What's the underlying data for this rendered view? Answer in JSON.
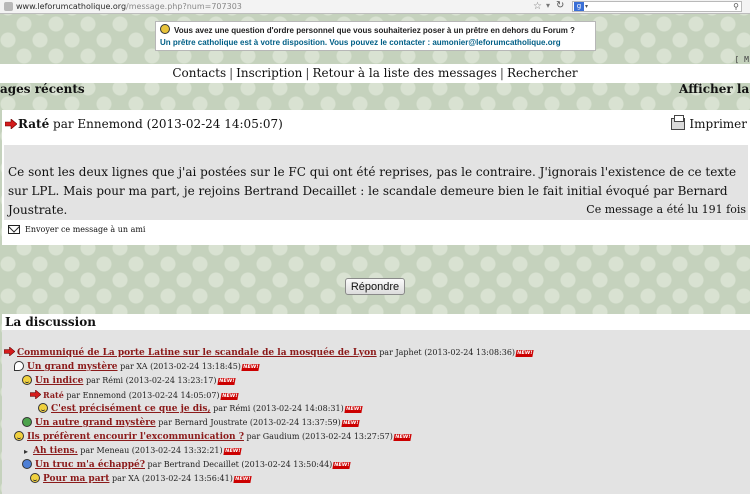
{
  "browser": {
    "url_domain": "www.leforumcatholique.org",
    "url_path": "/message.php?num=707303"
  },
  "notice": {
    "line1": "Vous avez une question d'ordre personnel que vous souhaiteriez poser à un prêtre en dehors du Forum ?",
    "line2": "Un prêtre catholique est à votre disposition. Vous pouvez le contacter : aumonier@leforumcatholique.org"
  },
  "edge_label": "[ M",
  "nav": {
    "contacts": "Contacts",
    "inscription": "Inscription",
    "retour": "Retour à la liste des messages",
    "rechercher": "Rechercher",
    "sep": "|"
  },
  "recent": {
    "left": "ages récents",
    "right": "Afficher la dis"
  },
  "message": {
    "title": "Raté",
    "by": "par Ennemond (2013-02-24 14:05:07)",
    "print_label": "Imprimer",
    "body": "Ce sont les deux lignes que j'ai postées sur le FC qui ont été reprises, pas le contraire. J'ignorais l'existence de ce texte sur LPL. Mais pour ma part, je rejoins Bertrand Decaillet : le scandale demeure bien le fait initial évoqué par Bernard Joustrate.",
    "read_count": "Ce message a été lu 191 fois",
    "send_label": "Envoyer ce message à un ami"
  },
  "reply_label": "Répondre",
  "discussion": {
    "heading": "La discussion",
    "new_badge": "NEW!",
    "rows": [
      {
        "title": "Communiqué de La porte Latine sur le scandale de la mosquée de Lyon",
        "meta": "par Japhet (2013-02-24 13:08:36)",
        "icon": "red-arrow"
      },
      {
        "title": "Un grand mystère",
        "meta": "par XA (2013-02-24 13:18:45)",
        "icon": "speech-bubble"
      },
      {
        "title": "Un indice",
        "meta": "par Rémi (2013-02-24 13:23:17)",
        "icon": "smiley"
      },
      {
        "title": "Raté",
        "meta": "par Ennemond (2013-02-24 14:05:07)",
        "icon": "red-arrow"
      },
      {
        "title": "C'est précisément ce que je dis,",
        "meta": "par Rémi (2013-02-24 14:08:31)",
        "icon": "smiley"
      },
      {
        "title": "Un autre grand mystère",
        "meta": "par Bernard Joustrate (2013-02-24 13:37:59)",
        "icon": "check"
      },
      {
        "title": "Ils préfèrent encourir l'excommunication ?",
        "meta": "par Gaudium (2013-02-24 13:27:57)",
        "icon": "smiley"
      },
      {
        "title": "Ah tiens.",
        "meta": "par Meneau (2013-02-24 13:32:21)",
        "icon": "bullet"
      },
      {
        "title": "Un truc m'a échappé?",
        "meta": "par Bertrand Decaillet (2013-02-24 13:50:44)",
        "icon": "blue-face"
      },
      {
        "title": "Pour ma part",
        "meta": "par XA (2013-02-24 13:56:41)",
        "icon": "smiley"
      }
    ]
  }
}
